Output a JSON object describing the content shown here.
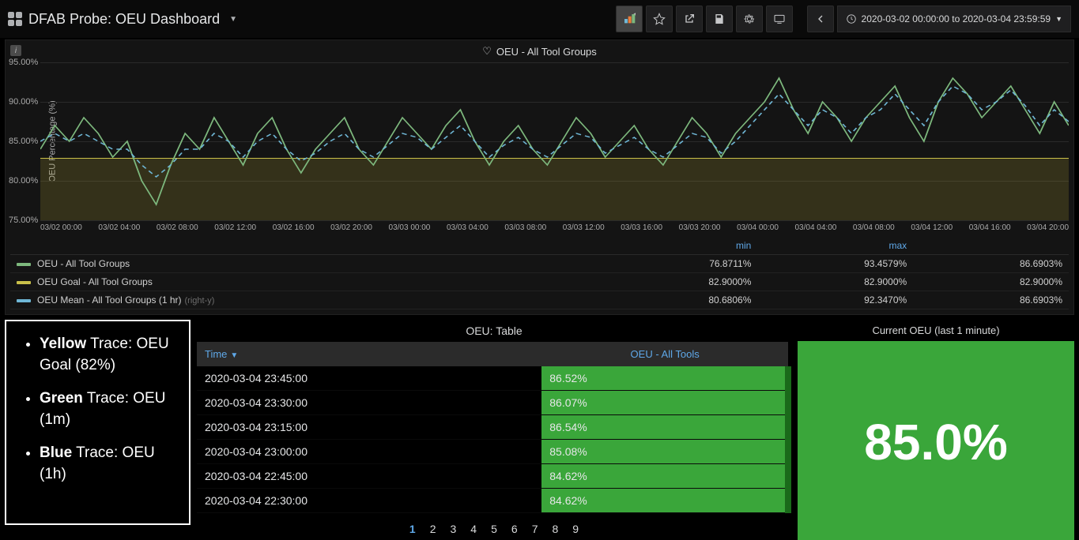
{
  "header": {
    "title": "DFAB Probe: OEU Dashboard",
    "time_range": "2020-03-02 00:00:00 to 2020-03-04 23:59:59"
  },
  "toolbar_icons": [
    "add-panel-icon",
    "star-icon",
    "share-icon",
    "save-icon",
    "gear-icon",
    "monitor-icon",
    "chevron-left-icon",
    "clock-icon"
  ],
  "chart_panel": {
    "title": "OEU - All Tool Groups",
    "y_label": "OEU Percentage (%)",
    "legend_headers": [
      "",
      "min",
      "max",
      ""
    ],
    "series": [
      {
        "name": "OEU - All Tool Groups",
        "color": "#7db87d",
        "min": "76.8711%",
        "max": "93.4579%",
        "last": "86.6903%"
      },
      {
        "name": "OEU Goal - All Tool Groups",
        "color": "#c9c04a",
        "min": "82.9000%",
        "max": "82.9000%",
        "last": "82.9000%"
      },
      {
        "name": "OEU Mean - All Tool Groups (1 hr)",
        "color": "#6fb7d6",
        "right_y": "(right-y)",
        "min": "80.6806%",
        "max": "92.3470%",
        "last": "86.6903%"
      }
    ]
  },
  "chart_data": {
    "type": "line",
    "title": "OEU - All Tool Groups",
    "ylabel": "OEU Percentage (%)",
    "ylim": [
      75,
      95
    ],
    "y_ticks": [
      "75.00%",
      "80.00%",
      "85.00%",
      "90.00%",
      "95.00%"
    ],
    "x_ticks": [
      "03/02 00:00",
      "03/02 04:00",
      "03/02 08:00",
      "03/02 12:00",
      "03/02 16:00",
      "03/02 20:00",
      "03/03 00:00",
      "03/03 04:00",
      "03/03 08:00",
      "03/03 12:00",
      "03/03 16:00",
      "03/03 20:00",
      "03/04 00:00",
      "03/04 04:00",
      "03/04 08:00",
      "03/04 12:00",
      "03/04 16:00",
      "03/04 20:00"
    ],
    "goal": 82.9,
    "series": [
      {
        "name": "OEU - All Tool Groups",
        "color": "#7db87d",
        "values": [
          84,
          87,
          85,
          88,
          86,
          83,
          85,
          80,
          77,
          82,
          86,
          84,
          88,
          85,
          82,
          86,
          88,
          84,
          81,
          84,
          86,
          88,
          84,
          82,
          85,
          88,
          86,
          84,
          87,
          89,
          85,
          82,
          85,
          87,
          84,
          82,
          85,
          88,
          86,
          83,
          85,
          87,
          84,
          82,
          85,
          88,
          86,
          83,
          86,
          88,
          90,
          93,
          89,
          86,
          90,
          88,
          85,
          88,
          90,
          92,
          88,
          85,
          90,
          93,
          91,
          88,
          90,
          92,
          89,
          86,
          90,
          87
        ]
      },
      {
        "name": "OEU Mean - All Tool Groups (1 hr)",
        "color": "#6fb7d6",
        "dashed": true,
        "values": [
          85,
          86,
          85,
          86,
          85,
          84,
          84,
          82,
          80.5,
          82,
          84,
          84,
          86,
          85,
          83,
          85,
          86,
          84,
          82.5,
          83.5,
          85,
          86,
          84,
          83,
          84.5,
          86,
          85.5,
          84,
          85.5,
          87,
          85,
          83,
          84.5,
          85.5,
          84,
          83,
          84.5,
          86,
          85.5,
          83.5,
          84.5,
          85.5,
          84,
          83,
          84.5,
          86,
          85.5,
          83.5,
          85,
          87,
          89,
          91,
          89,
          87,
          89,
          88,
          86,
          88,
          89,
          91,
          89,
          87,
          90,
          92,
          91,
          89,
          90,
          91.5,
          89.5,
          87,
          89,
          87.5
        ]
      }
    ]
  },
  "table_panel": {
    "title": "OEU: Table",
    "columns": [
      "Time",
      "OEU - All Tools"
    ],
    "rows": [
      {
        "time": "2020-03-04 23:45:00",
        "value": "86.52%"
      },
      {
        "time": "2020-03-04 23:30:00",
        "value": "86.07%"
      },
      {
        "time": "2020-03-04 23:15:00",
        "value": "86.54%"
      },
      {
        "time": "2020-03-04 23:00:00",
        "value": "85.08%"
      },
      {
        "time": "2020-03-04 22:45:00",
        "value": "84.62%"
      },
      {
        "time": "2020-03-04 22:30:00",
        "value": "84.62%"
      }
    ],
    "pages": [
      "1",
      "2",
      "3",
      "4",
      "5",
      "6",
      "7",
      "8",
      "9"
    ],
    "active_page": "1"
  },
  "gauge_panel": {
    "title": "Current OEU (last 1 minute)",
    "value": "85.0%"
  },
  "overlay": {
    "items": [
      {
        "bold": "Yellow",
        "rest": " Trace: OEU Goal (82%)"
      },
      {
        "bold": "Green",
        "rest": " Trace: OEU (1m)"
      },
      {
        "bold": "Blue",
        "rest": " Trace: OEU (1h)"
      }
    ]
  }
}
